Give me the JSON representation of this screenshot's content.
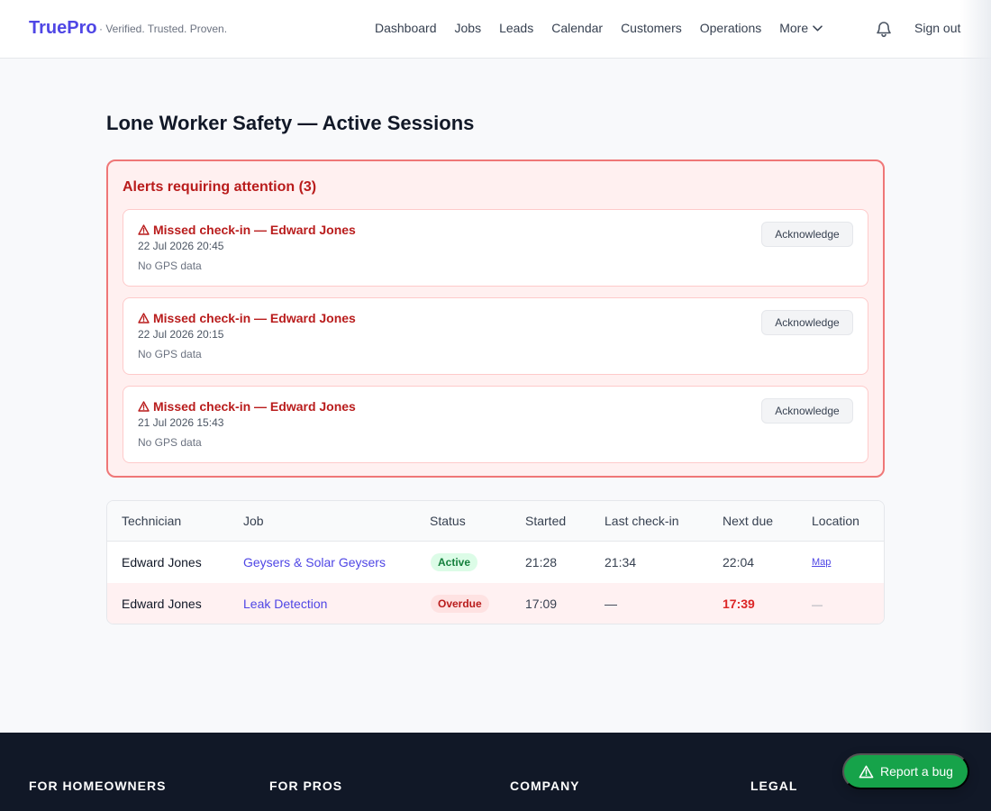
{
  "nav": {
    "brand": "TruePro",
    "tagline": "· Verified. Trusted. Proven.",
    "links": [
      "Dashboard",
      "Jobs",
      "Leads",
      "Calendar",
      "Customers",
      "Operations"
    ],
    "more_label": "More",
    "sign_out": "Sign out",
    "icons": [
      "chevron-down-icon",
      "bell-icon"
    ]
  },
  "page": {
    "title": "Lone Worker Safety — Active Sessions"
  },
  "alerts": {
    "title": "Alerts requiring attention (3)",
    "items": [
      {
        "heading": "Missed check-in — Edward Jones",
        "date": "22 Jul 2026 20:45",
        "gps": "No GPS data",
        "action": "Acknowledge"
      },
      {
        "heading": "Missed check-in — Edward Jones",
        "date": "22 Jul 2026 20:15",
        "gps": "No GPS data",
        "action": "Acknowledge"
      },
      {
        "heading": "Missed check-in — Edward Jones",
        "date": "21 Jul 2026 15:43",
        "gps": "No GPS data",
        "action": "Acknowledge"
      }
    ],
    "icon": "warning-icon"
  },
  "sessions": {
    "headers": [
      "Technician",
      "Job",
      "Status",
      "Started",
      "Last check-in",
      "Next due",
      "Location"
    ],
    "rows": [
      {
        "technician": "Edward Jones",
        "job": "Geysers & Solar Geysers",
        "status": "Active",
        "started": "21:28",
        "last_checkin": "21:34",
        "next_due": "22:04",
        "location": "Map"
      },
      {
        "technician": "Edward Jones",
        "job": "Leak Detection",
        "status": "Overdue",
        "started": "17:09",
        "last_checkin": "—",
        "next_due": "17:39",
        "location": "—"
      }
    ]
  },
  "footer": {
    "headings": [
      "FOR HOMEOWNERS",
      "FOR PROS",
      "COMPANY",
      "LEGAL"
    ]
  },
  "report_bug": {
    "label": "Report a bug",
    "icon": "warning-icon"
  },
  "colors": {
    "brand": "#4f46e5",
    "danger": "#b91c1c",
    "success": "#16a34a",
    "footer": "#111827"
  }
}
